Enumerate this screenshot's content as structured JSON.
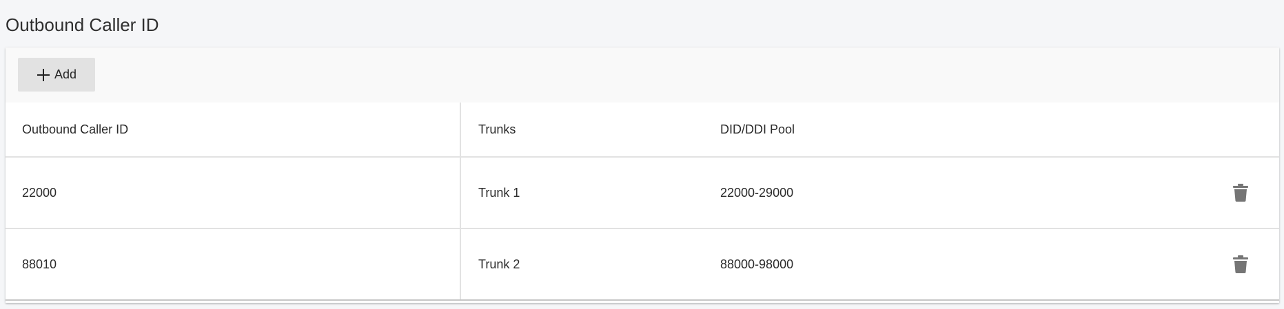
{
  "page": {
    "title": "Outbound Caller ID"
  },
  "toolbar": {
    "add_label": "Add"
  },
  "table": {
    "columns": [
      "Outbound Caller ID",
      "Trunks",
      "DID/DDI Pool"
    ],
    "rows": [
      {
        "caller_id": "22000",
        "trunk": "Trunk 1",
        "pool": "22000-29000"
      },
      {
        "caller_id": "88010",
        "trunk": "Trunk 2",
        "pool": "88000-98000"
      }
    ]
  },
  "icons": {
    "add": "plus-icon",
    "delete": "trash-icon"
  },
  "colors": {
    "background": "#f5f6f8",
    "toolbar": "#f9f9f9",
    "add_button": "#e2e2e2",
    "icon": "#757575",
    "divider": "#e2e2e2"
  }
}
